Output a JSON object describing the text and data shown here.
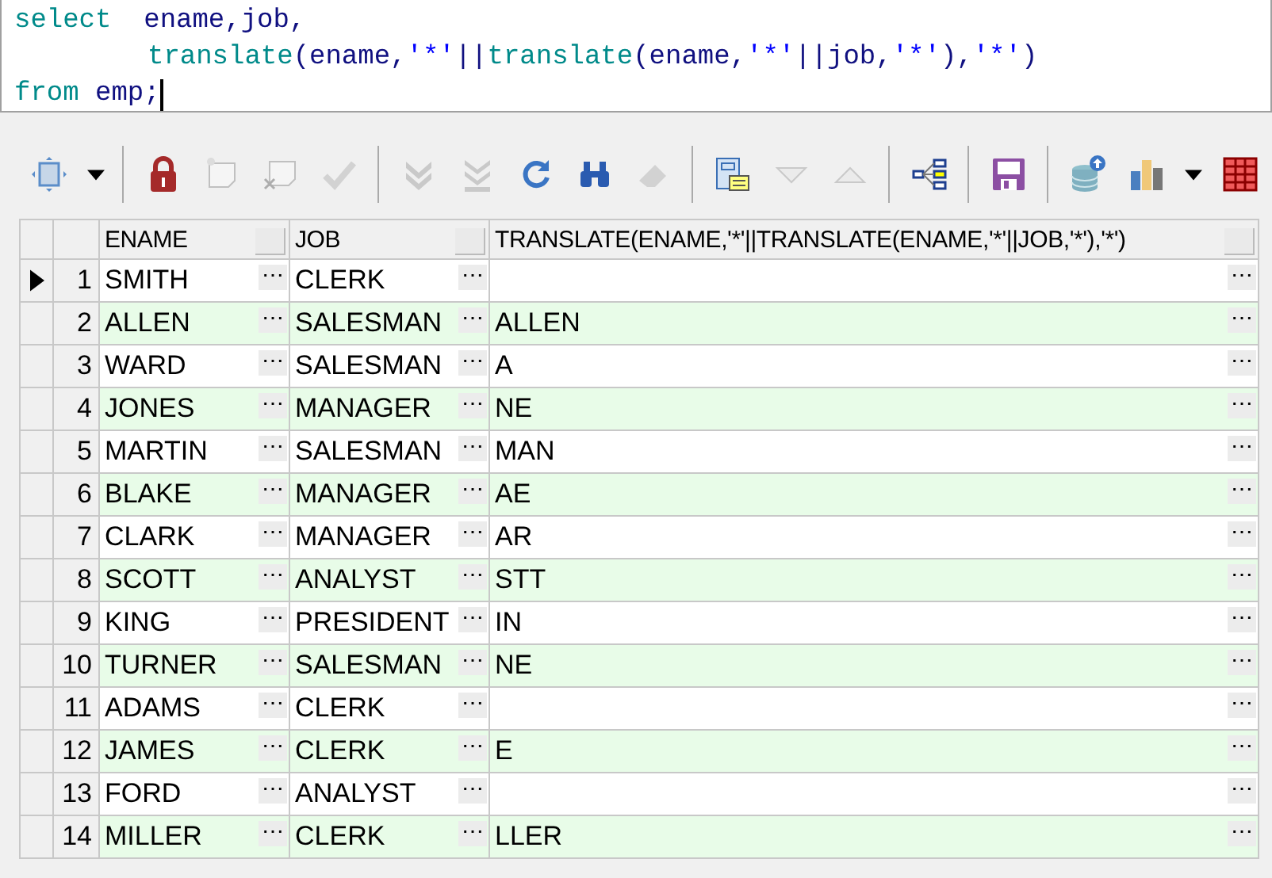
{
  "editor": {
    "lines": [
      {
        "tokens": [
          {
            "kind": "keyword",
            "text": "select"
          },
          {
            "kind": "plain",
            "text": "  ename,job,"
          }
        ]
      },
      {
        "indented": true,
        "tokens": [
          {
            "kind": "keyword",
            "text": "translate"
          },
          {
            "kind": "plain",
            "text": "(ename,"
          },
          {
            "kind": "string",
            "text": "'*'"
          },
          {
            "kind": "plain",
            "text": "||"
          },
          {
            "kind": "keyword",
            "text": "translate"
          },
          {
            "kind": "plain",
            "text": "(ename,"
          },
          {
            "kind": "string",
            "text": "'*'"
          },
          {
            "kind": "plain",
            "text": "||job,"
          },
          {
            "kind": "string",
            "text": "'*'"
          },
          {
            "kind": "plain",
            "text": "),"
          },
          {
            "kind": "string",
            "text": "'*'"
          },
          {
            "kind": "plain",
            "text": ")"
          }
        ]
      },
      {
        "tokens": [
          {
            "kind": "keyword",
            "text": "from"
          },
          {
            "kind": "plain",
            "text": " emp;"
          }
        ],
        "cursor": true
      }
    ]
  },
  "toolbar": [
    {
      "kind": "button",
      "disabled": false
    },
    {
      "kind": "dropdown",
      "disabled": false
    },
    {
      "kind": "separator"
    },
    {
      "kind": "button",
      "disabled": false
    },
    {
      "kind": "button",
      "disabled": true
    },
    {
      "kind": "button",
      "disabled": true
    },
    {
      "kind": "button",
      "disabled": true
    },
    {
      "kind": "separator"
    },
    {
      "kind": "button",
      "disabled": true
    },
    {
      "kind": "button",
      "disabled": true
    },
    {
      "kind": "button",
      "disabled": false
    },
    {
      "kind": "button",
      "disabled": false
    },
    {
      "kind": "button",
      "disabled": true
    },
    {
      "kind": "separator"
    },
    {
      "kind": "button",
      "disabled": false
    },
    {
      "kind": "button",
      "disabled": true
    },
    {
      "kind": "button",
      "disabled": true
    },
    {
      "kind": "separator"
    },
    {
      "kind": "button",
      "disabled": false
    },
    {
      "kind": "separator"
    },
    {
      "kind": "button",
      "disabled": false
    },
    {
      "kind": "separator"
    },
    {
      "kind": "button",
      "disabled": false
    },
    {
      "kind": "button",
      "disabled": false
    },
    {
      "kind": "dropdown",
      "disabled": false
    },
    {
      "kind": "button",
      "disabled": false
    }
  ],
  "table": {
    "columns": [
      "ENAME",
      "JOB",
      "TRANSLATE(ENAME,'*'||TRANSLATE(ENAME,'*'||JOB,'*'),'*')"
    ],
    "rows": [
      {
        "number": "1",
        "cells": [
          "SMITH",
          "CLERK",
          ""
        ],
        "buttons": [
          "⋯",
          "⋯",
          "⋯"
        ],
        "selected": true
      },
      {
        "number": "2",
        "cells": [
          "ALLEN",
          "SALESMAN",
          "ALLEN"
        ],
        "buttons": [
          "⋯",
          "⋯",
          "⋯"
        ],
        "selected": false
      },
      {
        "number": "3",
        "cells": [
          "WARD",
          "SALESMAN",
          "A"
        ],
        "buttons": [
          "⋯",
          "⋯",
          "⋯"
        ],
        "selected": false
      },
      {
        "number": "4",
        "cells": [
          "JONES",
          "MANAGER",
          "NE"
        ],
        "buttons": [
          "⋯",
          "⋯",
          "⋯"
        ],
        "selected": false
      },
      {
        "number": "5",
        "cells": [
          "MARTIN",
          "SALESMAN",
          "MAN"
        ],
        "buttons": [
          "⋯",
          "⋯",
          "⋯"
        ],
        "selected": false
      },
      {
        "number": "6",
        "cells": [
          "BLAKE",
          "MANAGER",
          "AE"
        ],
        "buttons": [
          "⋯",
          "⋯",
          "⋯"
        ],
        "selected": false
      },
      {
        "number": "7",
        "cells": [
          "CLARK",
          "MANAGER",
          "AR"
        ],
        "buttons": [
          "⋯",
          "⋯",
          "⋯"
        ],
        "selected": false
      },
      {
        "number": "8",
        "cells": [
          "SCOTT",
          "ANALYST",
          "STT"
        ],
        "buttons": [
          "⋯",
          "⋯",
          "⋯"
        ],
        "selected": false
      },
      {
        "number": "9",
        "cells": [
          "KING",
          "PRESIDENT",
          "IN"
        ],
        "buttons": [
          "⋯",
          "⋯",
          "⋯"
        ],
        "selected": false
      },
      {
        "number": "10",
        "cells": [
          "TURNER",
          "SALESMAN",
          "NE"
        ],
        "buttons": [
          "⋯",
          "⋯",
          "⋯"
        ],
        "selected": false
      },
      {
        "number": "11",
        "cells": [
          "ADAMS",
          "CLERK",
          ""
        ],
        "buttons": [
          "⋯",
          "⋯",
          "⋯"
        ],
        "selected": false
      },
      {
        "number": "12",
        "cells": [
          "JAMES",
          "CLERK",
          "E"
        ],
        "buttons": [
          "⋯",
          "⋯",
          "⋯"
        ],
        "selected": false
      },
      {
        "number": "13",
        "cells": [
          "FORD",
          "ANALYST",
          ""
        ],
        "buttons": [
          "⋯",
          "⋯",
          "⋯"
        ],
        "selected": false
      },
      {
        "number": "14",
        "cells": [
          "MILLER",
          "CLERK",
          "LLER"
        ],
        "buttons": [
          "⋯",
          "⋯",
          "⋯"
        ],
        "selected": false
      }
    ]
  }
}
